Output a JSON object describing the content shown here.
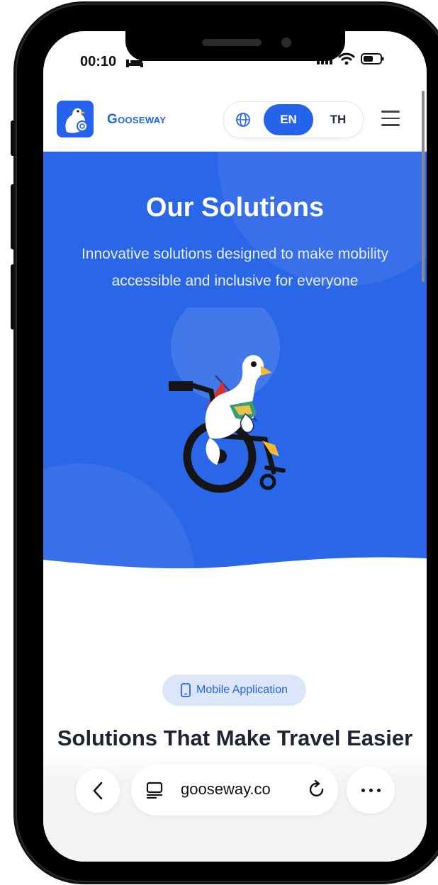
{
  "status_bar": {
    "time": "00:10"
  },
  "header": {
    "brand": "Gooseway",
    "lang": {
      "en": "EN",
      "th": "TH",
      "active": "EN"
    }
  },
  "hero": {
    "title": "Our Solutions",
    "subtitle": "Innovative solutions designed to make mobility accessible and inclusive for everyone"
  },
  "section": {
    "pill_label": "Mobile Application",
    "title": "Solutions That Make Travel Easier"
  },
  "browser": {
    "url": "gooseway.co"
  },
  "colors": {
    "primary": "#2563eb",
    "hero_bg": "#2a66e8",
    "pill_bg": "#dbe6fb",
    "title_dark": "#1e2433"
  }
}
